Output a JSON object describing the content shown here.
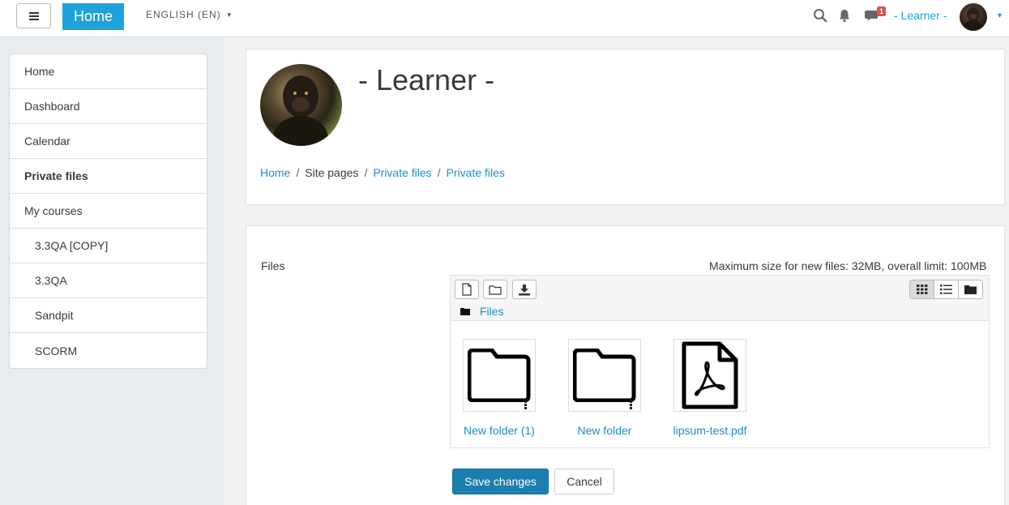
{
  "navbar": {
    "menu_icon": "hamburger-icon",
    "brand": "Home",
    "language": "ENGLISH (EN)",
    "search_icon": "search-icon",
    "bell_icon": "bell-icon",
    "messages_icon": "chat-icon",
    "messages_count": "1",
    "user_name": "- Learner -",
    "accent_color": "#1fa2d9"
  },
  "sidebar": {
    "items": [
      {
        "label": "Home"
      },
      {
        "label": "Dashboard"
      },
      {
        "label": "Calendar"
      },
      {
        "label": "Private files"
      },
      {
        "label": "My courses"
      },
      {
        "label": "3.3QA [COPY]"
      },
      {
        "label": "3.3QA"
      },
      {
        "label": "Sandpit"
      },
      {
        "label": "SCORM"
      }
    ]
  },
  "header": {
    "title": "- Learner -",
    "breadcrumb": [
      "Home",
      "Site pages",
      "Private files",
      "Private files"
    ]
  },
  "files": {
    "label": "Files",
    "max_size": "Maximum size for new files: 32MB, overall limit: 100MB",
    "path": "Files",
    "items": [
      {
        "name": "New folder (1)",
        "type": "folder"
      },
      {
        "name": "New folder",
        "type": "folder"
      },
      {
        "name": "lipsum-test.pdf",
        "type": "pdf"
      }
    ]
  },
  "actions": {
    "save": "Save changes",
    "cancel": "Cancel",
    "save_color": "#1a7fae"
  }
}
